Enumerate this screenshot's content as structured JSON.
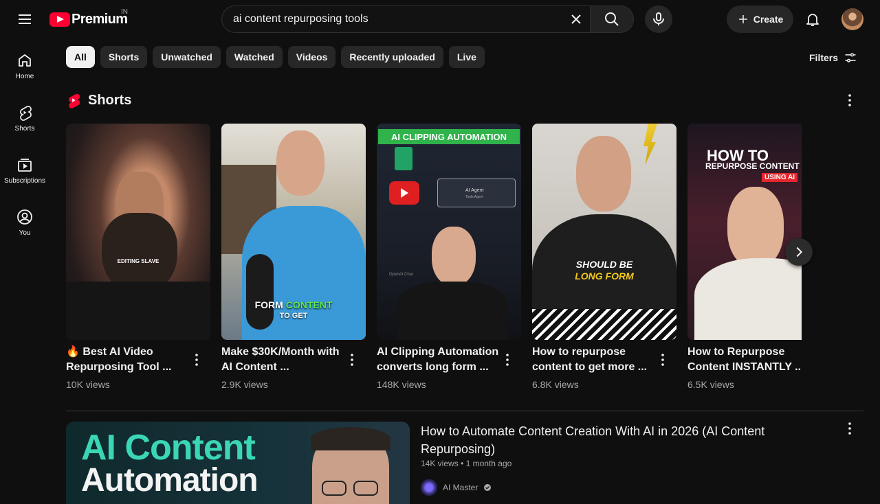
{
  "header": {
    "logo_text": "Premium",
    "country_code": "IN",
    "search_query": "ai content repurposing tools",
    "create_label": "Create"
  },
  "sidebar": {
    "items": [
      {
        "label": "Home",
        "icon": "home-icon"
      },
      {
        "label": "Shorts",
        "icon": "shorts-icon"
      },
      {
        "label": "Subscriptions",
        "icon": "subscriptions-icon"
      },
      {
        "label": "You",
        "icon": "you-icon"
      }
    ]
  },
  "chips": [
    "All",
    "Shorts",
    "Unwatched",
    "Watched",
    "Videos",
    "Recently uploaded",
    "Live"
  ],
  "active_chip": "All",
  "filters_label": "Filters",
  "shorts_section": {
    "title": "Shorts",
    "items": [
      {
        "title": "🔥 Best AI Video Repurposing Tool ...",
        "views": "10K views",
        "overlay": [
          "EDITING SLAVE"
        ]
      },
      {
        "title": "Make $30K/Month with AI Content ...",
        "views": "2.9K views",
        "overlay": [
          "FORM",
          "CONTENT",
          "TO GET"
        ]
      },
      {
        "title": "AI Clipping Automation converts long form ...",
        "views": "148K views",
        "overlay": [
          "AI CLIPPING AUTOMATION",
          "AI Agent",
          "Tools Agent",
          "OpenAI Chat"
        ]
      },
      {
        "title": "How to repurpose content to get more ...",
        "views": "6.8K views",
        "overlay": [
          "SHOULD BE",
          "LONG FORM"
        ]
      },
      {
        "title": "How to Repurpose Content INSTANTLY ...",
        "views": "6.5K views",
        "overlay": [
          "HOW TO",
          "REPURPOSE CONTENT",
          "USING AI"
        ]
      }
    ]
  },
  "video": {
    "thumb_line1": "AI Content",
    "thumb_line2": "Automation",
    "title": "How to Automate Content Creation With AI in 2026 (AI Content Repurposing)",
    "views": "14K views",
    "age": "1 month ago",
    "channel": "AI Master"
  },
  "colors": {
    "background": "#0f0f0f",
    "brand_red": "#ff0033",
    "chip_bg": "#272727",
    "chip_active_bg": "#f1f1f1",
    "accent_green": "#3ad6b6",
    "muted_text": "#aaaaaa"
  }
}
